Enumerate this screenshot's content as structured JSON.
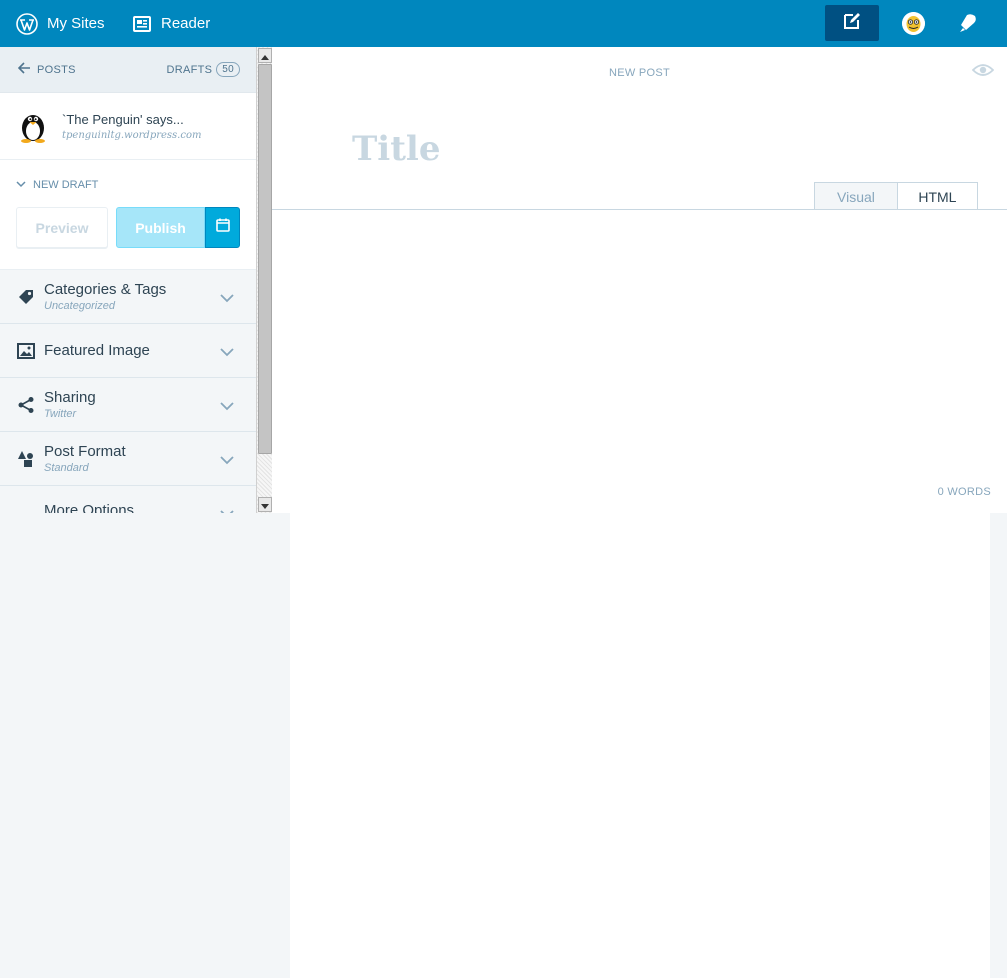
{
  "masterbar": {
    "my_sites_label": "My Sites",
    "reader_label": "Reader",
    "write_icon": "pencil-square-icon",
    "avatar_icon": "penguin-avatar-icon",
    "notifications_icon": "notification-bell-icon",
    "background_color": "#0087be"
  },
  "sidebar": {
    "back_label": "POSTS",
    "drafts_label": "DRAFTS",
    "drafts_count": "50",
    "site_title": "`The Penguin' says...",
    "site_url": "tpenguinltg.wordpress.com",
    "draft_status": "NEW DRAFT",
    "preview_label": "Preview",
    "publish_label": "Publish",
    "accordion": [
      {
        "title": "Categories & Tags",
        "subtitle": "Uncategorized",
        "icon": "tag-icon"
      },
      {
        "title": "Featured Image",
        "subtitle": "",
        "icon": "image-icon"
      },
      {
        "title": "Sharing",
        "subtitle": "Twitter",
        "icon": "share-icon"
      },
      {
        "title": "Post Format",
        "subtitle": "Standard",
        "icon": "shapes-icon"
      },
      {
        "title": "More Options",
        "subtitle": "",
        "icon": ""
      }
    ]
  },
  "editor": {
    "label": "NEW POST",
    "title_placeholder": "Title",
    "tabs": [
      {
        "label": "Visual",
        "active": false
      },
      {
        "label": "HTML",
        "active": true
      }
    ],
    "word_count": "0 WORDS"
  }
}
